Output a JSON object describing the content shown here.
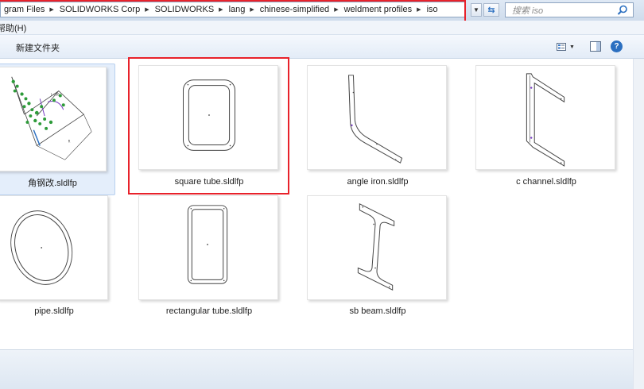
{
  "address": {
    "crumbs": [
      "gram Files",
      "SOLIDWORKS Corp",
      "SOLIDWORKS",
      "lang",
      "chinese-simplified",
      "weldment profiles",
      "iso"
    ]
  },
  "search": {
    "placeholder": "搜索 iso"
  },
  "menu": {
    "items": [
      "帮助(H)"
    ]
  },
  "toolbar": {
    "new_folder_label": "新建文件夹",
    "help_label": "?"
  },
  "files": [
    {
      "name": "角钢改.sldlfp",
      "icon": "angle-sketch-thumbnail",
      "selected": true
    },
    {
      "name": "square tube.sldlfp",
      "icon": "square-tube-thumbnail",
      "selected": false
    },
    {
      "name": "angle iron.sldlfp",
      "icon": "angle-iron-thumbnail",
      "selected": false
    },
    {
      "name": "c channel.sldlfp",
      "icon": "c-channel-thumbnail",
      "selected": false
    },
    {
      "name": "pipe.sldlfp",
      "icon": "pipe-thumbnail",
      "selected": false
    },
    {
      "name": "rectangular tube.sldlfp",
      "icon": "rectangular-tube-thumbnail",
      "selected": false
    },
    {
      "name": "sb beam.sldlfp",
      "icon": "sb-beam-thumbnail",
      "selected": false
    }
  ],
  "colors": {
    "highlight_box": "#e8222b",
    "selection": "#e4eefb",
    "sketch_green": "#2e9b3a",
    "sketch_purple": "#7a3fc4"
  }
}
